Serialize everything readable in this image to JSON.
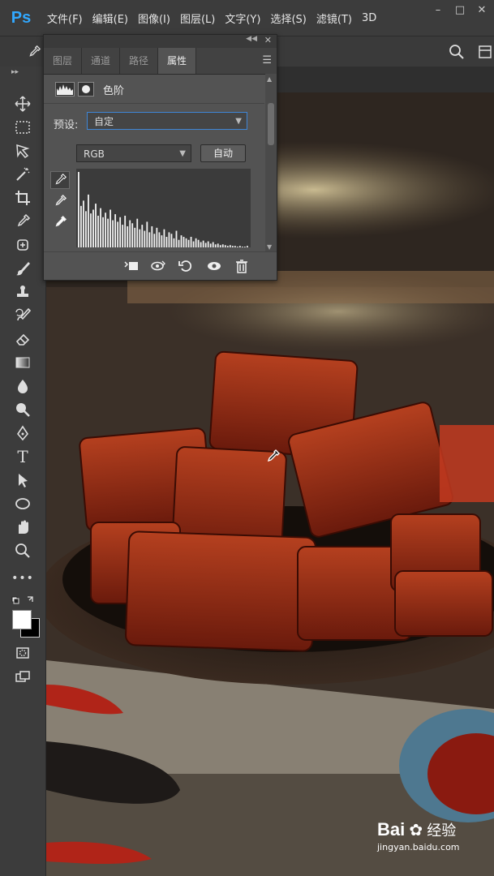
{
  "app": {
    "logo": "Ps"
  },
  "menu": {
    "items": [
      "文件(F)",
      "编辑(E)",
      "图像(I)",
      "图层(L)",
      "文字(Y)",
      "选择(S)",
      "滤镜(T)",
      "3D"
    ]
  },
  "panel": {
    "tabs": [
      "图层",
      "通道",
      "路径",
      "属性"
    ],
    "active_tab": "属性",
    "adjustment_title": "色阶",
    "preset_label": "预设:",
    "preset_value": "自定",
    "channel_value": "RGB",
    "auto_button": "自动"
  },
  "histogram": {
    "bars": [
      1.0,
      0.55,
      0.62,
      0.48,
      0.7,
      0.45,
      0.5,
      0.58,
      0.42,
      0.52,
      0.4,
      0.46,
      0.38,
      0.5,
      0.36,
      0.44,
      0.34,
      0.4,
      0.3,
      0.42,
      0.28,
      0.36,
      0.32,
      0.26,
      0.38,
      0.24,
      0.3,
      0.22,
      0.34,
      0.2,
      0.28,
      0.18,
      0.26,
      0.2,
      0.16,
      0.24,
      0.14,
      0.2,
      0.18,
      0.12,
      0.22,
      0.1,
      0.16,
      0.14,
      0.12,
      0.1,
      0.14,
      0.08,
      0.12,
      0.1,
      0.07,
      0.09,
      0.06,
      0.08,
      0.05,
      0.07,
      0.04,
      0.05,
      0.03,
      0.04,
      0.03,
      0.02,
      0.03,
      0.02,
      0.02,
      0.01,
      0.02,
      0.01,
      0.01,
      0.02
    ]
  },
  "watermark": {
    "brand": "Bai",
    "brand2": "经验",
    "url": "jingyan.baidu.com"
  }
}
